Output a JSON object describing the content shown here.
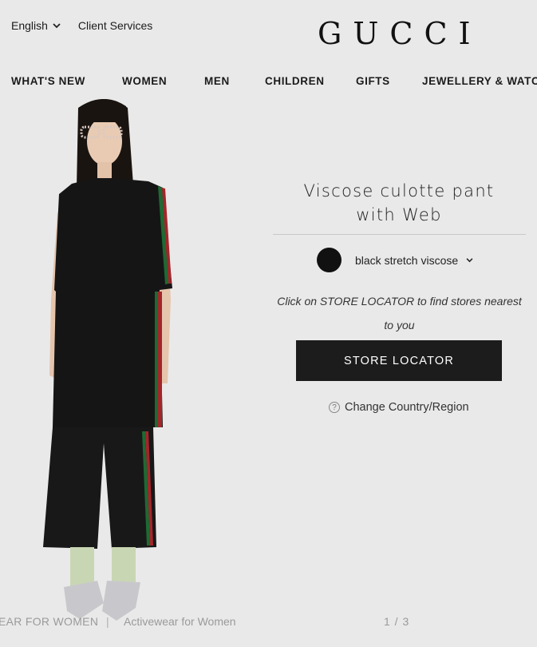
{
  "header": {
    "language": "English",
    "client_services": "Client Services",
    "logo": "GUCCI"
  },
  "nav": {
    "items": [
      "WHAT'S NEW",
      "WOMEN",
      "MEN",
      "CHILDREN",
      "GIFTS",
      "JEWELLERY & WATCHES"
    ]
  },
  "product": {
    "title_line1": "Viscose culotte pant",
    "title_line2": "with Web",
    "color_name": "black stretch viscose",
    "color_hex": "#111111",
    "store_hint": "Click on STORE LOCATOR to find stores nearest to you",
    "store_button": "STORE LOCATOR",
    "change_region": "Change Country/Region"
  },
  "footer": {
    "crumb_primary": "EAR FOR WOMEN",
    "separator": "|",
    "crumb_secondary": "Activewear for Women",
    "pager": "1 / 3"
  },
  "icons": [
    "chevron-down-icon",
    "question-icon"
  ]
}
